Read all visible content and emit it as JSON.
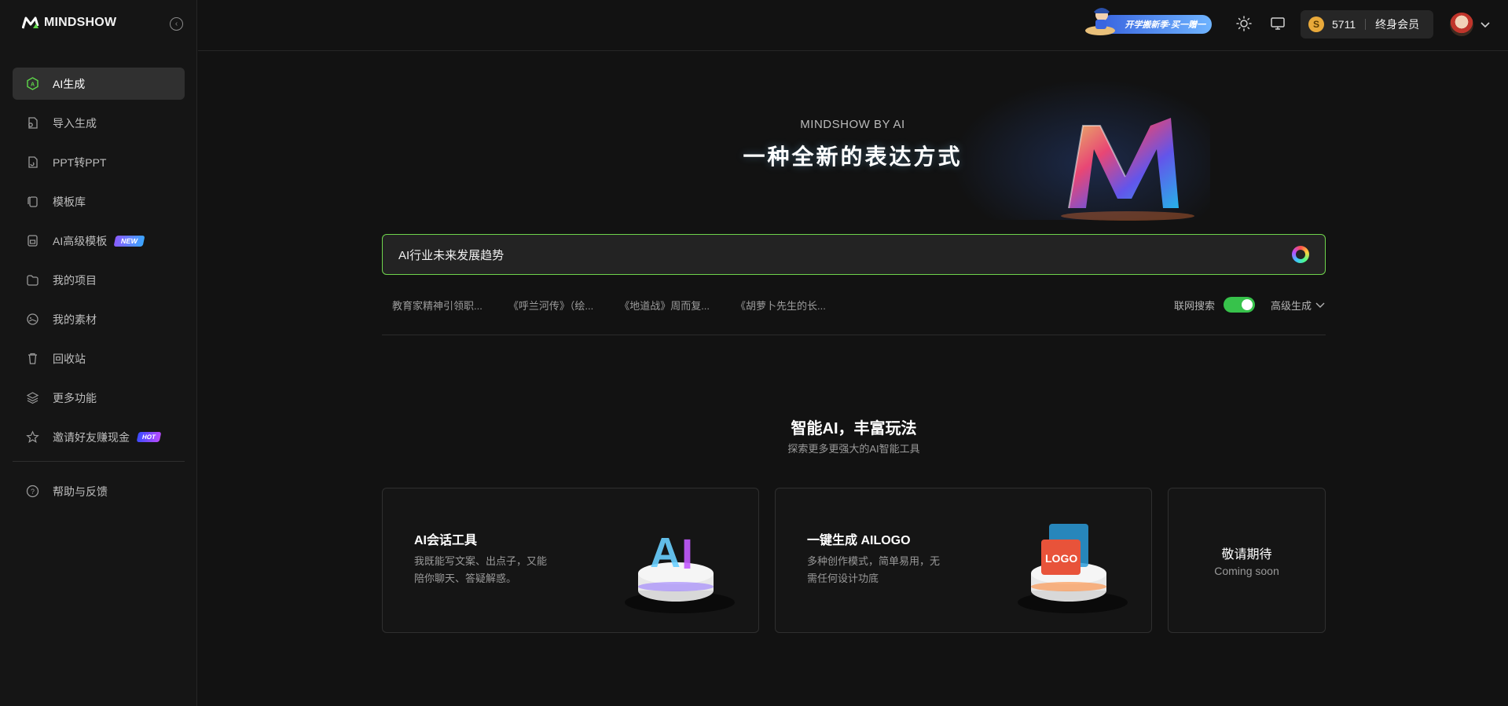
{
  "brand": {
    "logo_text": "MINDSHOW"
  },
  "sidebar": {
    "items": [
      {
        "label": "AI生成",
        "active": true
      },
      {
        "label": "导入生成"
      },
      {
        "label": "PPT转PPT"
      },
      {
        "label": "模板库"
      },
      {
        "label": "AI高级模板",
        "badge": "NEW"
      },
      {
        "label": "我的项目"
      },
      {
        "label": "我的素材"
      },
      {
        "label": "回收站"
      },
      {
        "label": "更多功能"
      },
      {
        "label": "邀请好友赚现金",
        "badge": "HOT"
      }
    ],
    "footer_item": {
      "label": "帮助与反馈"
    }
  },
  "topbar": {
    "promo_text": "开学搬新季·买一赠一",
    "coin_symbol": "S",
    "coin_count": "5711",
    "membership": "终身会员"
  },
  "hero": {
    "subtitle": "MINDSHOW BY AI",
    "title": "一种全新的表达方式"
  },
  "search": {
    "value": "AI行业未来发展趋势"
  },
  "suggestions": [
    "教育家精神引领职...",
    "《呼兰河传》（绘...",
    "《地道战》周而复...",
    "《胡萝卜先生的长..."
  ],
  "controls": {
    "web_search_label": "联网搜索",
    "web_search_enabled": true,
    "advanced_label": "高级生成"
  },
  "features": {
    "title": "智能AI，丰富玩法",
    "subtitle": "探索更多更强大的AI智能工具",
    "cards": [
      {
        "title": "AI会话工具",
        "desc": "我既能写文案、出点子，又能陪你聊天、答疑解惑。"
      },
      {
        "title": "一键生成 AILOGO",
        "desc": "多种创作模式，简单易用，无需任何设计功底"
      }
    ],
    "coming": {
      "title": "敬请期待",
      "subtitle": "Coming soon"
    }
  },
  "colors": {
    "accent": "#6fd44c",
    "toggle_on": "#37c24b",
    "coin": "#e9a93a"
  }
}
